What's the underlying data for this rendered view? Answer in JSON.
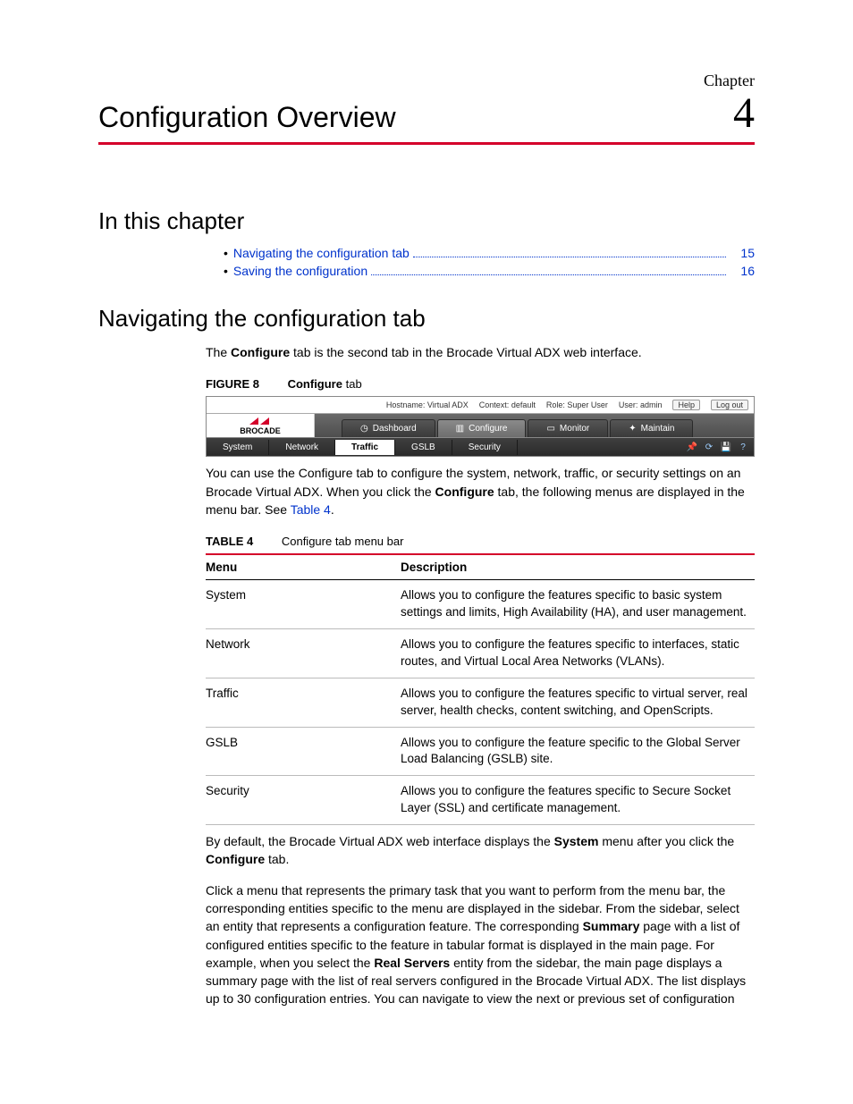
{
  "chapterLabel": "Chapter",
  "chapterNumber": "4",
  "chapterTitle": "Configuration Overview",
  "sections": {
    "inThisChapter": "In this chapter",
    "navigating": "Navigating the configuration tab"
  },
  "toc": [
    {
      "text": "Navigating the configuration tab",
      "page": "15"
    },
    {
      "text": "Saving the configuration",
      "page": "16"
    }
  ],
  "para1_a": "The ",
  "para1_b": "Configure",
  "para1_c": " tab is the second tab in the Brocade Virtual ADX web interface.",
  "figure": {
    "label": "FIGURE 8",
    "boldPart": "Configure",
    "rest": " tab"
  },
  "uiMock": {
    "hostname_k": "Hostname:",
    "hostname_v": "Virtual ADX",
    "context_k": "Context:",
    "context_v": "default",
    "role_k": "Role:",
    "role_v": "Super User",
    "user_k": "User:",
    "user_v": "admin",
    "help": "Help",
    "logout": "Log out",
    "brand": "BROCADE",
    "tabs": [
      "Dashboard",
      "Configure",
      "Monitor",
      "Maintain"
    ],
    "menus": [
      "System",
      "Network",
      "Traffic",
      "GSLB",
      "Security"
    ]
  },
  "para2_a": "You can use the Configure tab to configure the system, network, traffic, or security settings on an Brocade Virtual ADX. When you click the ",
  "para2_b": "Configure",
  "para2_c": " tab, the following menus are displayed in the menu bar. See ",
  "para2_d": "Table 4",
  "para2_e": ".",
  "tableCaption": {
    "label": "TABLE 4",
    "text": "Configure tab menu bar"
  },
  "tableHead": {
    "c1": "Menu",
    "c2": "Description"
  },
  "tableRows": [
    {
      "menu": "System",
      "desc": "Allows you to configure the features specific to basic system settings and limits, High Availability (HA), and user management."
    },
    {
      "menu": "Network",
      "desc": "Allows you to configure the features specific to interfaces, static routes, and Virtual Local Area Networks (VLANs)."
    },
    {
      "menu": "Traffic",
      "desc": "Allows you to configure the features specific to virtual server, real server, health checks, content switching, and OpenScripts."
    },
    {
      "menu": "GSLB",
      "desc": "Allows you to configure the feature specific to the Global Server Load Balancing (GSLB) site."
    },
    {
      "menu": "Security",
      "desc": "Allows you to configure the features specific to Secure Socket Layer (SSL) and certificate management."
    }
  ],
  "para3_a": "By default, the Brocade Virtual ADX web interface displays the ",
  "para3_b": "System",
  "para3_c": " menu after you click the ",
  "para3_d": "Configure",
  "para3_e": " tab.",
  "para4_a": "Click a menu that represents the primary task that you want to perform from the menu bar, the corresponding entities specific to the menu are displayed in the sidebar. From the sidebar, select an entity that represents a configuration feature. The corresponding ",
  "para4_b": "Summary",
  "para4_c": " page with a list of configured entities specific to the feature in tabular format is displayed in the main page. For example, when you select the ",
  "para4_d": "Real Servers",
  "para4_e": " entity from the sidebar, the main page displays a summary page with the list of real servers configured in the Brocade Virtual ADX. The list displays up to 30 configuration entries. You can navigate to view the next or previous set of configuration"
}
